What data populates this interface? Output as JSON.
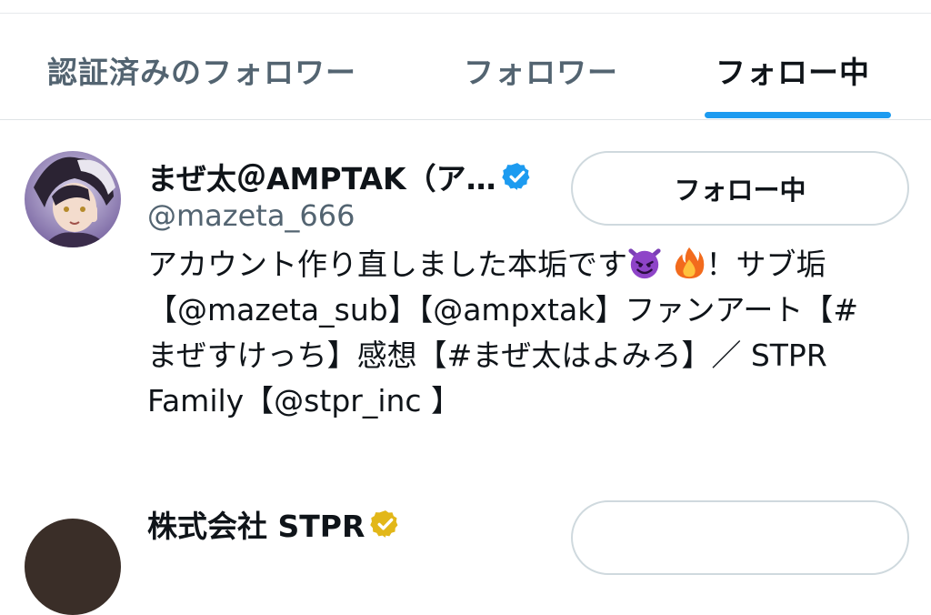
{
  "tabs": [
    {
      "label": "認証済みのフォロワー",
      "active": false
    },
    {
      "label": "フォロワー",
      "active": false
    },
    {
      "label": "フォロー中",
      "active": true
    }
  ],
  "colors": {
    "accent": "#1d9bf0",
    "verified_blue": "#1d9bf0",
    "verified_gold": "#e2b719"
  },
  "users": [
    {
      "display_name": "まぜ太＠AMPTAK（ア…",
      "handle": "@mazeta_666",
      "verified": "blue",
      "follow_label": "フォロー中",
      "bio": {
        "line1_a": "アカウント作り直しました本垢です",
        "emoji1": "smiling-devil",
        "emoji2": "fire",
        "line1_b": "！サブ垢",
        "line2": "【@mazeta_sub】【@ampxtak】ファンアート【#",
        "line3": "まぜすけっち】感想【#まぜ太はよみろ】／ STPR",
        "line4": "Family【@stpr_inc 】"
      }
    },
    {
      "display_name": "株式会社 STPR",
      "verified": "gold"
    }
  ]
}
